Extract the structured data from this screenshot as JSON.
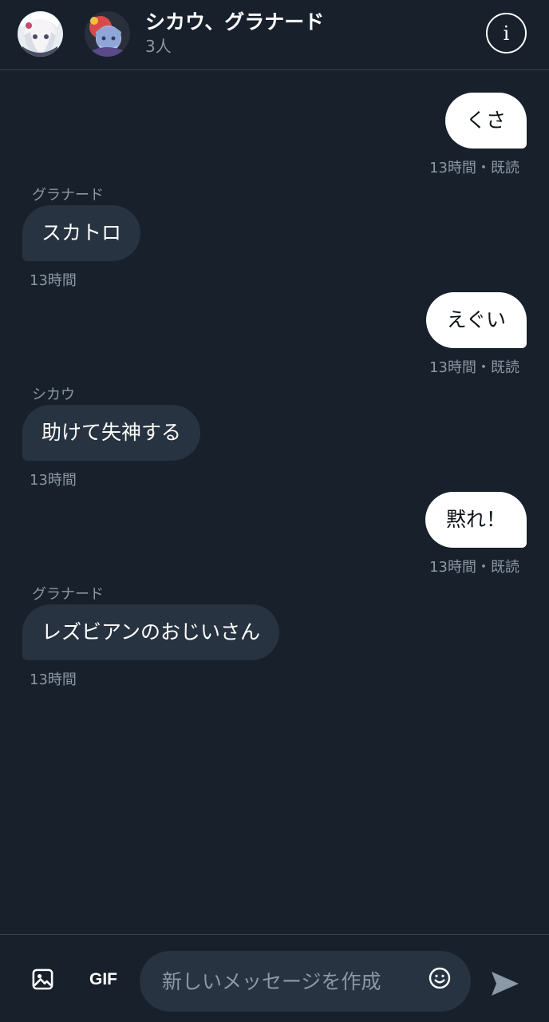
{
  "header": {
    "title": "シカウ、グラナード",
    "subtitle": "3人",
    "info_label": "i",
    "avatars": [
      "avatar-1",
      "avatar-2"
    ]
  },
  "messages": [
    {
      "direction": "out",
      "text": "くさ",
      "meta": "13時間・既読"
    },
    {
      "direction": "in",
      "sender": "グラナード",
      "text": "スカトロ",
      "meta": "13時間"
    },
    {
      "direction": "out",
      "text": "えぐい",
      "meta": "13時間・既読"
    },
    {
      "direction": "in",
      "sender": "シカウ",
      "text": "助けて失神する",
      "meta": "13時間"
    },
    {
      "direction": "out",
      "text": "黙れ！",
      "meta": "13時間・既読"
    },
    {
      "direction": "in",
      "sender": "グラナード",
      "text": "レズビアンのおじいさん",
      "meta": "13時間"
    }
  ],
  "composer": {
    "gif_label": "GIF",
    "placeholder": "新しいメッセージを作成",
    "value": ""
  },
  "icons": {
    "image": "image-icon",
    "emoji": "emoji-icon",
    "send": "send-icon",
    "info": "info-icon"
  },
  "colors": {
    "background": "#17202b",
    "incoming_bubble": "#273340",
    "outgoing_bubble": "#ffffff",
    "muted_text": "#8b98a5"
  }
}
